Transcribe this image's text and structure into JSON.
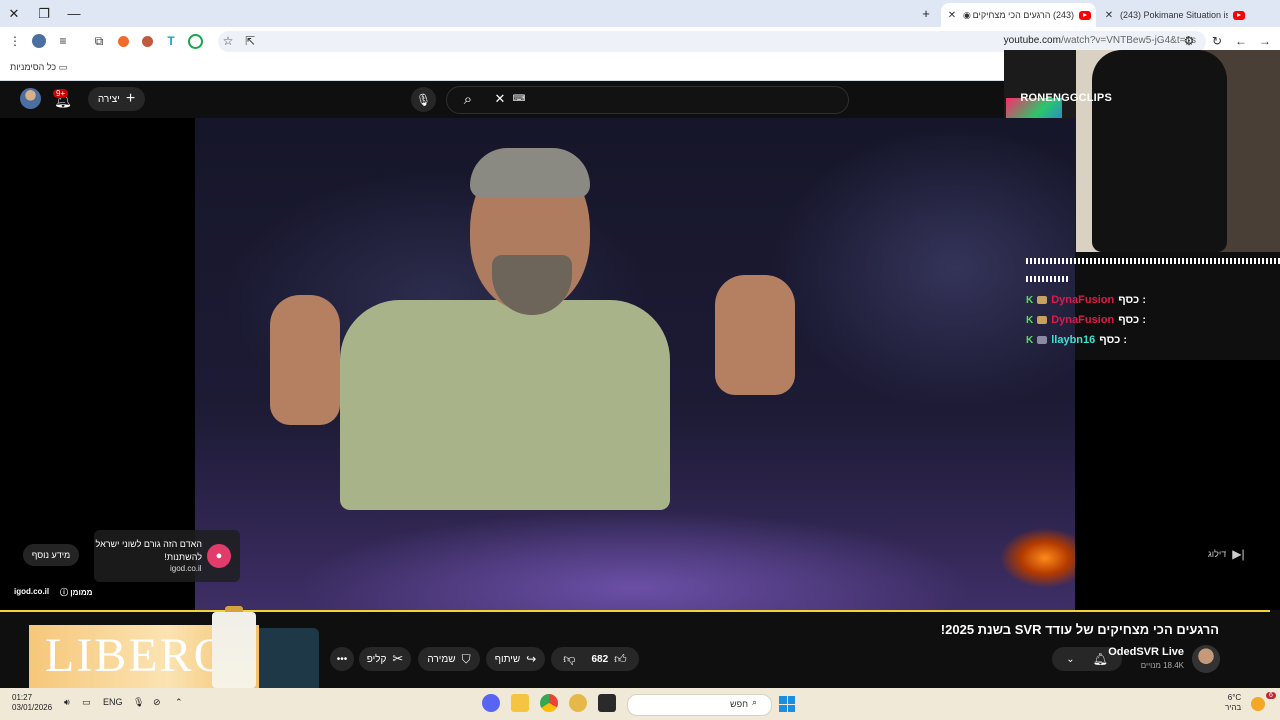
{
  "browser": {
    "tabs": [
      {
        "title": "(243) הרגעים הכי מצחיקים",
        "active": true
      },
      {
        "title": "(243) Pokimane Situation is Ge",
        "active": false
      }
    ],
    "new_tab_icon": "+",
    "url_domain": "youtube.com",
    "url_path": "/watch?v=VNTBew5-jG4&t=1s",
    "bookmarks_label": "כל הסימניות"
  },
  "youtube": {
    "search_value": "RONENGGCLIPS",
    "create_label": "יצירה",
    "notif_badge": "9+",
    "video_title": "הרגעים הכי מצחיקים של עודד SVR בשנת 2025!",
    "channel_name": "OdedSVR Live",
    "subscribers": "18.4K מנויים",
    "likes": "682",
    "share_label": "שיתוף",
    "save_label": "שמירה",
    "clip_label": "קליפ",
    "skip_label": "דילוג"
  },
  "ad": {
    "title": "האדם הזה גורם לשוני ישראל להשתנות!",
    "url": "igod.co.il",
    "more_info": "מידע נוסף",
    "footer_url": "igod.co.il",
    "sponsored": "ממומן",
    "banner_brand": "LIBERO"
  },
  "stream_chat": [
    {
      "name": "DynaFusion",
      "text": ": כסף",
      "color": "#e0194b"
    },
    {
      "name": "DynaFusion",
      "text": ": כסף",
      "color": "#e0194b"
    },
    {
      "name": "llaybn16",
      "text": ": כסף",
      "color": "#3ee0d0"
    }
  ],
  "taskbar": {
    "time": "01:27",
    "date": "03/01/2026",
    "lang": "ENG",
    "search_placeholder": "חפש",
    "temperature": "6°C",
    "weather_desc": "בהיר",
    "weather_badge": "6"
  }
}
